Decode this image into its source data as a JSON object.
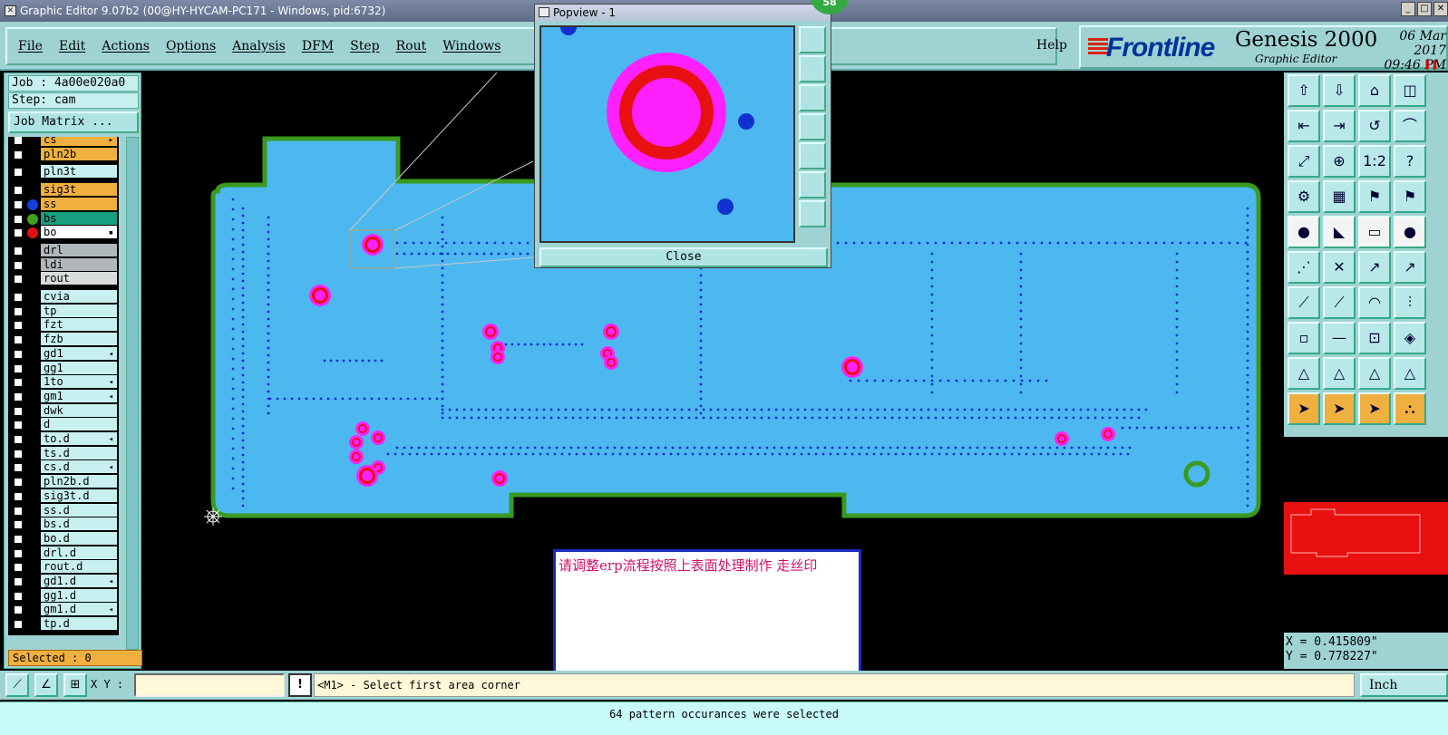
{
  "window": {
    "title": "Graphic Editor 9.07b2 (00@HY-HYCAM-PC171 - Windows, pid:6732)"
  },
  "menu": [
    "File",
    "Edit",
    "Actions",
    "Options",
    "Analysis",
    "DFM",
    "Step",
    "Rout",
    "Windows"
  ],
  "help_label": "Help",
  "brand": {
    "logo": "Frontline",
    "product": "Genesis 2000",
    "subtitle": "Graphic Editor",
    "date": "06 Mar 2017",
    "time": "09:46 PM",
    "pause_icon": "pause-icon"
  },
  "job": {
    "job_line": "Job : 4a00e020a0",
    "step_line": "Step: cam",
    "matrix_button": "Job Matrix ..."
  },
  "layers": [
    {
      "name": "cs",
      "color": "#f0b040",
      "mark": "▸",
      "dot": ""
    },
    {
      "name": "pln2b",
      "color": "#f0b040",
      "mark": "",
      "dot": ""
    },
    {
      "name": "pln3t",
      "color": "#c8f0f0",
      "mark": "",
      "dot": ""
    },
    {
      "name": "sig3t",
      "color": "#f0b040",
      "mark": "",
      "dot": ""
    },
    {
      "name": "ss",
      "color": "#f0b040",
      "mark": "",
      "dot": "#1040e0"
    },
    {
      "name": "bs",
      "color": "#18a080",
      "mark": "",
      "dot": "#40a020"
    },
    {
      "name": "bo",
      "color": "#ffffff",
      "mark": "▪",
      "dot": "#e01010"
    },
    {
      "name": "drl",
      "color": "#b0b8bc",
      "mark": "",
      "dot": ""
    },
    {
      "name": "ldi",
      "color": "#b0b8bc",
      "mark": "",
      "dot": ""
    },
    {
      "name": "rout",
      "color": "#d8dcdc",
      "mark": "",
      "dot": ""
    },
    {
      "name": "cvia",
      "color": "#c8f0f0",
      "mark": "",
      "dot": ""
    },
    {
      "name": "tp",
      "color": "#c8f0f0",
      "mark": "",
      "dot": ""
    },
    {
      "name": "fzt",
      "color": "#c8f0f0",
      "mark": "",
      "dot": ""
    },
    {
      "name": "fzb",
      "color": "#c8f0f0",
      "mark": "",
      "dot": ""
    },
    {
      "name": "gd1",
      "color": "#c8f0f0",
      "mark": "◂",
      "dot": ""
    },
    {
      "name": "gg1",
      "color": "#c8f0f0",
      "mark": "",
      "dot": ""
    },
    {
      "name": "1to",
      "color": "#c8f0f0",
      "mark": "◂",
      "dot": ""
    },
    {
      "name": "gm1",
      "color": "#c8f0f0",
      "mark": "◂",
      "dot": ""
    },
    {
      "name": "dwk",
      "color": "#c8f0f0",
      "mark": "",
      "dot": ""
    },
    {
      "name": "d",
      "color": "#c8f0f0",
      "mark": "",
      "dot": ""
    },
    {
      "name": "to.d",
      "color": "#c8f0f0",
      "mark": "◂",
      "dot": ""
    },
    {
      "name": "ts.d",
      "color": "#c8f0f0",
      "mark": "",
      "dot": ""
    },
    {
      "name": "cs.d",
      "color": "#c8f0f0",
      "mark": "◂",
      "dot": ""
    },
    {
      "name": "pln2b.d",
      "color": "#c8f0f0",
      "mark": "",
      "dot": ""
    },
    {
      "name": "sig3t.d",
      "color": "#c8f0f0",
      "mark": "",
      "dot": ""
    },
    {
      "name": "ss.d",
      "color": "#c8f0f0",
      "mark": "",
      "dot": ""
    },
    {
      "name": "bs.d",
      "color": "#c8f0f0",
      "mark": "",
      "dot": ""
    },
    {
      "name": "bo.d",
      "color": "#c8f0f0",
      "mark": "",
      "dot": ""
    },
    {
      "name": "drl.d",
      "color": "#c8f0f0",
      "mark": "",
      "dot": ""
    },
    {
      "name": "rout.d",
      "color": "#c8f0f0",
      "mark": "",
      "dot": ""
    },
    {
      "name": "gd1.d",
      "color": "#c8f0f0",
      "mark": "◂",
      "dot": ""
    },
    {
      "name": "gg1.d",
      "color": "#c8f0f0",
      "mark": "",
      "dot": ""
    },
    {
      "name": "gm1.d",
      "color": "#c8f0f0",
      "mark": "◂",
      "dot": ""
    },
    {
      "name": "tp.d",
      "color": "#c8f0f0",
      "mark": "",
      "dot": ""
    }
  ],
  "selected": "Selected : 0",
  "popview": {
    "title": "Popview - 1",
    "badge": "58",
    "close_label": "Close"
  },
  "message": "请调整erp流程按照上表面处理制作  走丝印",
  "coords": {
    "x": "X = 0.415809\"",
    "y": "Y = 0.778227\""
  },
  "bottom": {
    "xy_label": "X Y :",
    "bang": "!",
    "prompt": "<M1> - Select first area corner",
    "unit": "Inch"
  },
  "status": "64 pattern occurances were selected",
  "colors": {
    "board": "#4db8f0",
    "outline": "#3a9a20",
    "pad": "#ff20ff",
    "pad_ring": "#e81010",
    "via": "#1030d0",
    "panel": "#9fd3d3",
    "highlight": "#f0b040"
  }
}
